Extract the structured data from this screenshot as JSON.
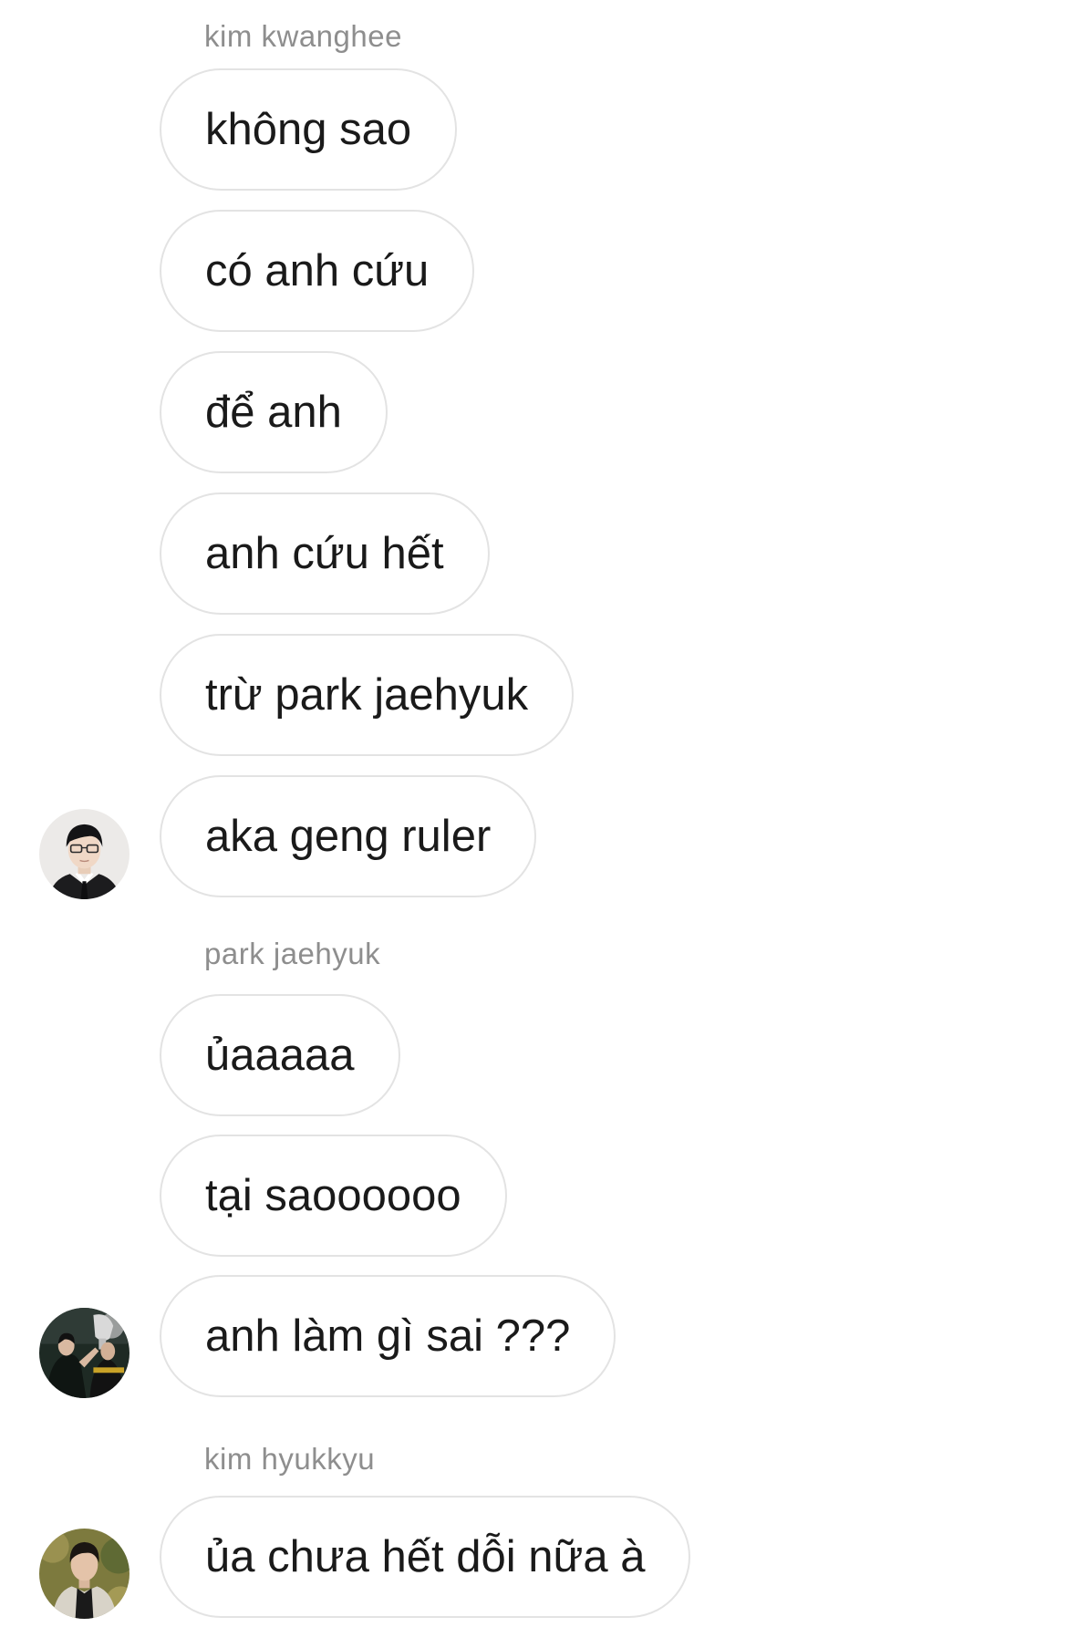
{
  "groups": [
    {
      "sender": "kim kwanghee",
      "avatar_icon": "profile-photo-suit-glasses-icon",
      "messages": [
        "không sao",
        "có anh cứu",
        "để anh",
        "anh cứu hết",
        "trừ park jaehyuk",
        "aka geng ruler"
      ]
    },
    {
      "sender": "park jaehyuk",
      "avatar_icon": "profile-photo-trophy-icon",
      "messages": [
        "ủaaaaa",
        "tại saoooooo",
        "anh làm gì sai ???"
      ]
    },
    {
      "sender": "kim hyukkyu",
      "avatar_icon": "profile-photo-outdoor-icon",
      "messages": [
        "ủa chưa hết dỗi nữa à"
      ]
    }
  ],
  "colors": {
    "bubble_border": "#e3e3e3",
    "sender_name": "#8e8e8e",
    "message_text": "#1a1a1a",
    "background": "#ffffff"
  }
}
